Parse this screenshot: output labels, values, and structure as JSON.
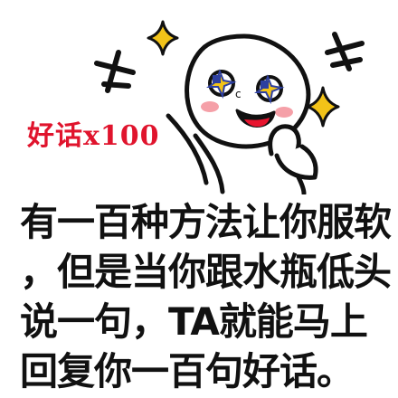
{
  "badge": {
    "text": "好话x100",
    "color": "#e0142d"
  },
  "caption": {
    "lines": [
      "有一百种方法让你服软",
      "，但是当你跟水瓶低头",
      "说一句，TA就能马上",
      "回复你一百句好话。"
    ]
  },
  "colors": {
    "ink": "#111111",
    "star_yellow": "#f2c318",
    "eye_blue": "#2d3fa0",
    "blush": "#f5a0a8",
    "tongue": "#e8152f"
  },
  "icons": [
    "star-sparkle-icon",
    "cross-sparkle-icon",
    "head-tilt-character"
  ]
}
